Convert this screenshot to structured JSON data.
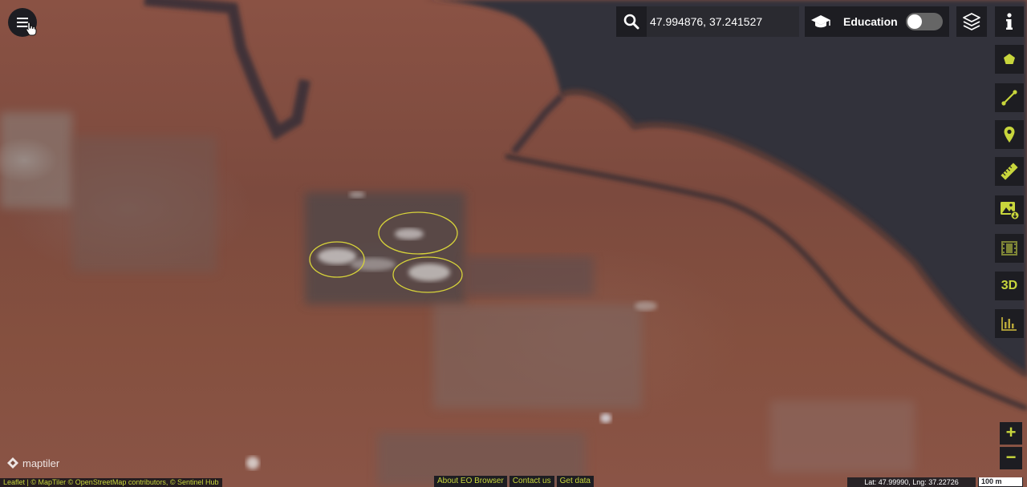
{
  "search": {
    "coordinates": "47.994876, 37.241527",
    "icon": "search-icon"
  },
  "education": {
    "label": "Education",
    "toggle_on": false
  },
  "toolbar": {
    "items": [
      {
        "name": "info-icon"
      },
      {
        "name": "polygon-icon"
      },
      {
        "name": "line-icon"
      },
      {
        "name": "pin-icon"
      },
      {
        "name": "ruler-icon"
      },
      {
        "name": "image-download-icon"
      },
      {
        "name": "film-icon"
      },
      {
        "name": "3d-label",
        "label": "3D"
      },
      {
        "name": "chart-icon"
      }
    ]
  },
  "zoom": {
    "in_label": "+",
    "out_label": "−"
  },
  "logo": {
    "text": "maptiler"
  },
  "attribution": {
    "text": "Leaflet | © MapTiler © OpenStreetMap contributors, © Sentinel Hub"
  },
  "footer": {
    "about": "About EO Browser",
    "contact": "Contact us",
    "get_data": "Get data"
  },
  "status": {
    "latlng": "Lat: 47.99990, Lng: 37.22726",
    "scale": "100 m"
  },
  "colors": {
    "accent": "#c8d63c",
    "panel": "#1d1d22",
    "water": "#2f3038",
    "highlight": "#d7d33a"
  }
}
